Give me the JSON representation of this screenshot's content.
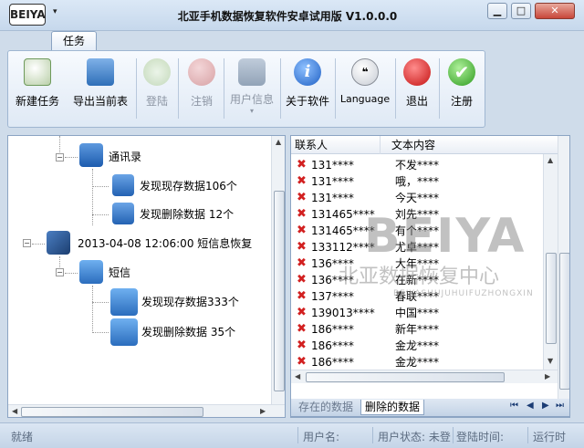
{
  "window": {
    "title": "北亚手机数据恢复软件安卓试用版 V1.0.0.0",
    "logo_text": "BEIYA",
    "min_symbol": "▁",
    "max_symbol": "□",
    "close_symbol": "✕",
    "quick_access": "▾"
  },
  "ribbon": {
    "tab": "任务",
    "buttons": {
      "new_task": "新建任务",
      "export": "导出当前表",
      "login": "登陆",
      "logout": "注销",
      "user_info": "用户信息",
      "about": "关于软件",
      "language": "Language",
      "exit": "退出",
      "register": "注册"
    },
    "about_glyph": "i",
    "language_glyph": "❝",
    "register_glyph": "✔",
    "dropdown_glyph": "▾"
  },
  "tree": {
    "contacts": "通讯录",
    "contacts_existing": "发现现存数据106个",
    "contacts_deleted": "发现删除数据 12个",
    "sms_recovery": "2013-04-08 12:06:00 短信息恢复",
    "sms": "短信",
    "sms_existing": "发现现存数据333个",
    "sms_deleted": "发现删除数据 35个"
  },
  "table": {
    "headers": [
      "联系人",
      "文本内容"
    ],
    "rows": [
      {
        "contact": "131****",
        "text": "不发****"
      },
      {
        "contact": "131****",
        "text": "哦，****"
      },
      {
        "contact": "131****",
        "text": "今天****"
      },
      {
        "contact": "131465****",
        "text": "刘先****"
      },
      {
        "contact": "131465****",
        "text": "有个****"
      },
      {
        "contact": "133112****",
        "text": "尤卓****"
      },
      {
        "contact": "136****",
        "text": "大年****"
      },
      {
        "contact": "136****",
        "text": "在新****"
      },
      {
        "contact": "137****",
        "text": "春联****"
      },
      {
        "contact": "139013****",
        "text": "中国****"
      },
      {
        "contact": "186****",
        "text": "新年****"
      },
      {
        "contact": "186****",
        "text": "金龙****"
      },
      {
        "contact": "186****",
        "text": "金龙****"
      }
    ],
    "delete_glyph": "✖"
  },
  "watermark": {
    "logo": "BEIYA",
    "chinese": "北亚数据恢复中心",
    "english": "BEIYASHUJUHUIFUZHONGXIN"
  },
  "bottom_tabs": {
    "existing": "存在的数据",
    "deleted": "删除的数据",
    "nav": [
      "⏮",
      "◀",
      "▶",
      "⏭"
    ]
  },
  "status": {
    "ready": "就绪",
    "username": "用户名:",
    "user_status": "用户状态: 未登",
    "login_time": "登陆时间:",
    "running": "运行时"
  }
}
